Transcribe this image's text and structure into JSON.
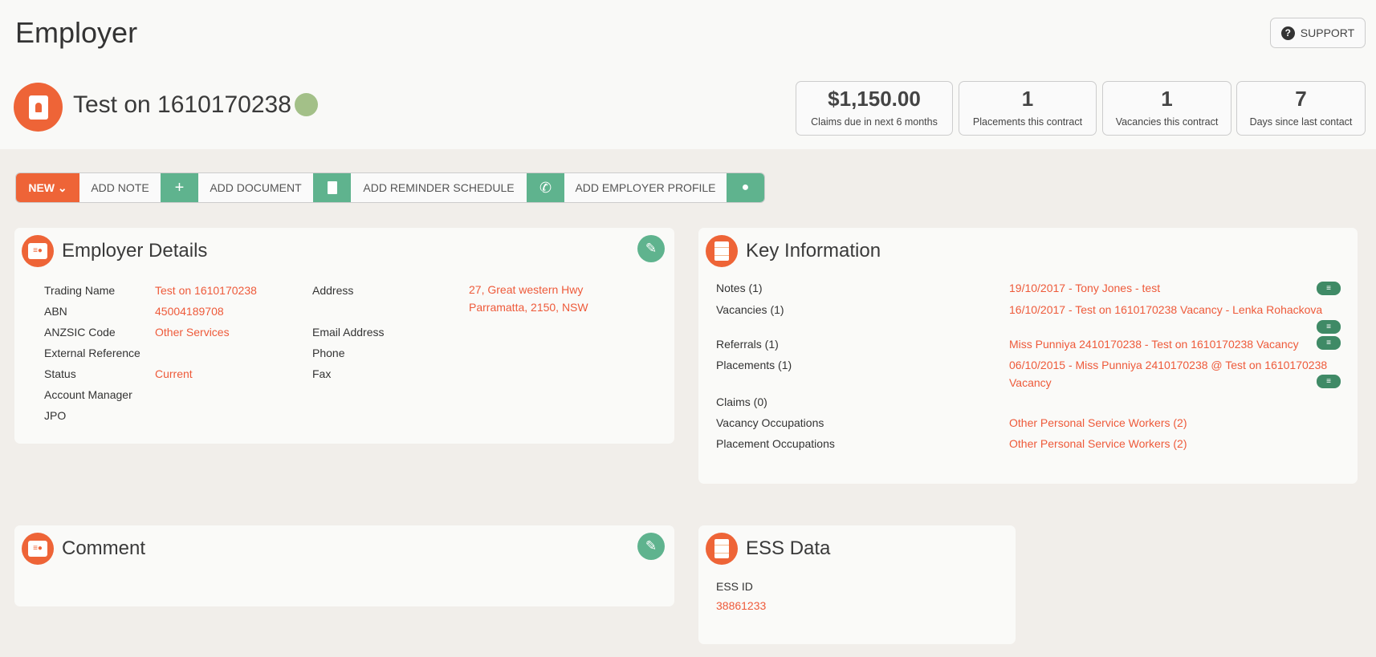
{
  "page": {
    "title": "Employer",
    "support_label": "SUPPORT"
  },
  "employer": {
    "name": "Test on 1610170238"
  },
  "stats": [
    {
      "value": "$1,150.00",
      "label": "Claims due in next 6 months"
    },
    {
      "value": "1",
      "label": "Placements this contract"
    },
    {
      "value": "1",
      "label": "Vacancies this contract"
    },
    {
      "value": "7",
      "label": "Days since last contact"
    }
  ],
  "toolbar": {
    "new": "NEW",
    "add_note": "ADD NOTE",
    "add_document": "ADD DOCUMENT",
    "add_reminder": "ADD REMINDER SCHEDULE",
    "add_profile": "ADD EMPLOYER PROFILE"
  },
  "details": {
    "title": "Employer Details",
    "left": [
      {
        "label": "Trading Name",
        "value": "Test on 1610170238"
      },
      {
        "label": "ABN",
        "value": "45004189708"
      },
      {
        "label": "ANZSIC Code",
        "value": "Other Services"
      },
      {
        "label": "External Reference",
        "value": ""
      },
      {
        "label": "Status",
        "value": "Current"
      },
      {
        "label": "Account Manager",
        "value": ""
      },
      {
        "label": "JPO",
        "value": ""
      }
    ],
    "address_label": "Address",
    "address_line1": "27, Great western Hwy",
    "address_line2": "Parramatta, 2150, NSW",
    "email_label": "Email Address",
    "phone_label": "Phone",
    "fax_label": "Fax"
  },
  "key_info": {
    "title": "Key Information",
    "notes_label": "Notes (1)",
    "notes_value": "19/10/2017 - Tony Jones - test",
    "vacancies_label": "Vacancies (1)",
    "vacancies_value": "16/10/2017 - Test on 1610170238 Vacancy - Lenka Rohackova",
    "referrals_label": "Referrals (1)",
    "referrals_value": "Miss Punniya 2410170238 - Test on 1610170238 Vacancy",
    "placements_label": "Placements (1)",
    "placements_value1": "06/10/2015 - Miss Punniya 2410170238 @ Test on 1610170238",
    "placements_value2": "Vacancy",
    "claims_label": "Claims (0)",
    "vac_occ_label": "Vacancy Occupations",
    "vac_occ_value": "Other Personal Service Workers (2)",
    "pl_occ_label": "Placement Occupations",
    "pl_occ_value": "Other Personal Service Workers (2)"
  },
  "comment": {
    "title": "Comment"
  },
  "ess": {
    "title": "ESS Data",
    "id_label": "ESS ID",
    "id_value": "38861233"
  },
  "colors": {
    "accent": "#ee6437",
    "green": "#5fb38e",
    "link": "#ee5a3a"
  }
}
